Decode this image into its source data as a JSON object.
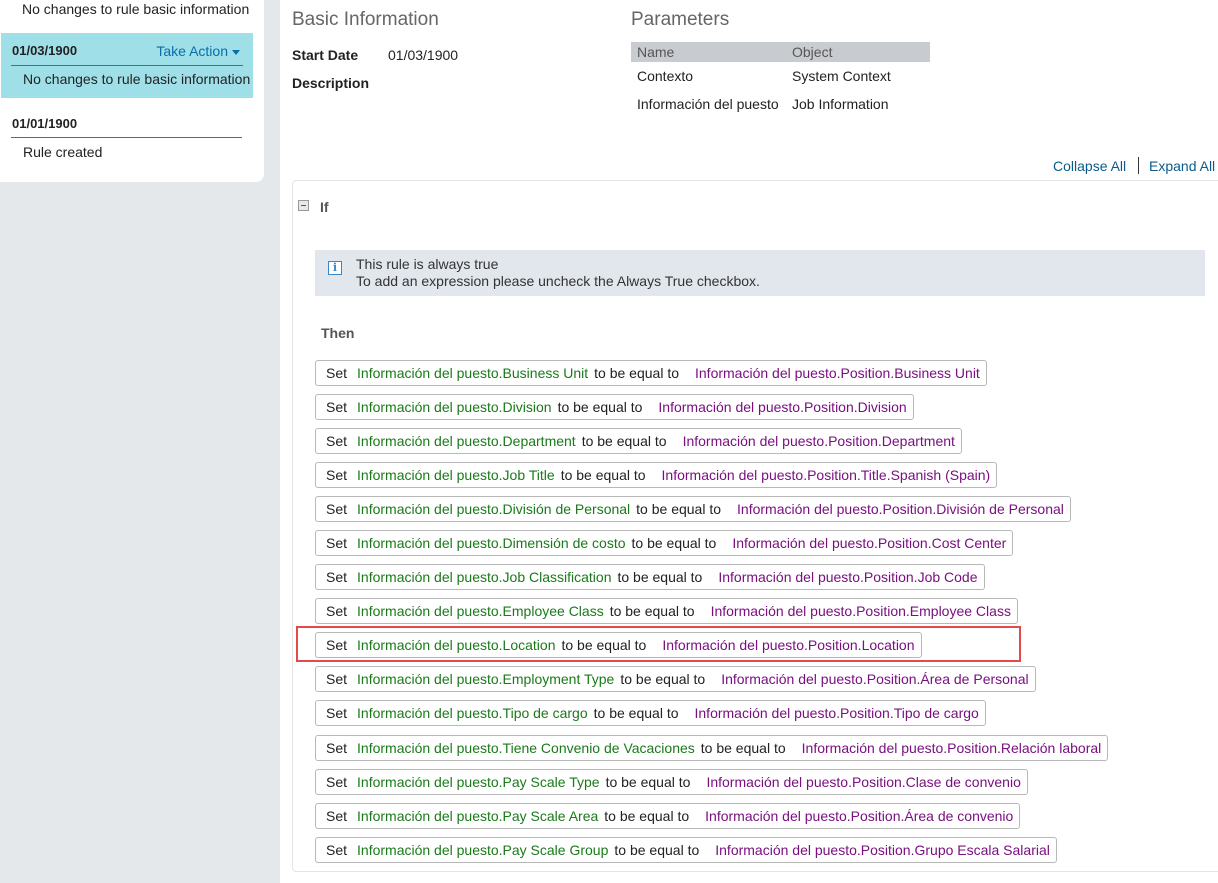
{
  "history": {
    "top_entry_text": "No changes to rule basic information",
    "selected_entry": {
      "date": "01/03/1900",
      "action_label": "Take Action",
      "text": "No changes to rule basic information"
    },
    "last_entry": {
      "date": "01/01/1900",
      "text": "Rule created"
    }
  },
  "basic_info": {
    "title": "Basic Information",
    "start_date_label": "Start Date",
    "start_date_value": "01/03/1900",
    "description_label": "Description"
  },
  "parameters": {
    "title": "Parameters",
    "columns": [
      "Name",
      "Object"
    ],
    "rows": [
      {
        "name": "Contexto",
        "object": "System Context"
      },
      {
        "name": "Información del puesto",
        "object": "Job Information"
      }
    ]
  },
  "links": {
    "collapse_all": "Collapse All",
    "expand_all": "Expand All"
  },
  "rule": {
    "if_label": "If",
    "info_line1": "This rule is always true",
    "info_line2": "To add an expression please uncheck the Always True checkbox.",
    "then_label": "Then",
    "set_keyword": "Set",
    "equal_keyword": "to be equal to",
    "assignments": [
      {
        "target": "Información del puesto.Business Unit",
        "value": "Información del puesto.Position.Business Unit"
      },
      {
        "target": "Información del puesto.Division",
        "value": "Información del puesto.Position.Division"
      },
      {
        "target": "Información del puesto.Department",
        "value": "Información del puesto.Position.Department"
      },
      {
        "target": "Información del puesto.Job Title",
        "value": "Información del puesto.Position.Title.Spanish (Spain)"
      },
      {
        "target": "Información del puesto.División de Personal",
        "value": "Información del puesto.Position.División de Personal"
      },
      {
        "target": "Información del puesto.Dimensión de costo",
        "value": "Información del puesto.Position.Cost Center"
      },
      {
        "target": "Información del puesto.Job Classification",
        "value": "Información del puesto.Position.Job Code"
      },
      {
        "target": "Información del puesto.Employee Class",
        "value": "Información del puesto.Position.Employee Class"
      },
      {
        "target": "Información del puesto.Location",
        "value": "Información del puesto.Position.Location"
      },
      {
        "target": "Información del puesto.Employment Type",
        "value": "Información del puesto.Position.Área de Personal"
      },
      {
        "target": "Información del puesto.Tipo de cargo",
        "value": "Información del puesto.Position.Tipo de cargo"
      },
      {
        "target": "Información del puesto.Tiene Convenio de Vacaciones",
        "value": "Información del puesto.Position.Relación laboral"
      },
      {
        "target": "Información del puesto.Pay Scale Type",
        "value": "Información del puesto.Position.Clase de convenio"
      },
      {
        "target": "Información del puesto.Pay Scale Area",
        "value": "Información del puesto.Position.Área de convenio"
      },
      {
        "target": "Información del puesto.Pay Scale Group",
        "value": "Información del puesto.Position.Grupo Escala Salarial"
      }
    ]
  }
}
